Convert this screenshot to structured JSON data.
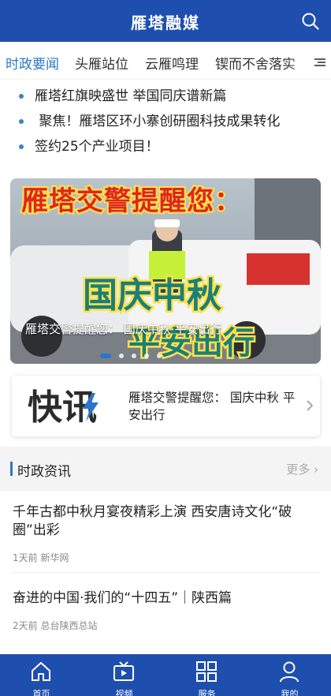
{
  "header": {
    "title": "雁塔融媒",
    "search_icon": "search-icon"
  },
  "tabs": [
    {
      "label": "时政要闻",
      "active": true
    },
    {
      "label": "头雁站位",
      "active": false
    },
    {
      "label": "云雁鸣理",
      "active": false
    },
    {
      "label": "锲而不舍落实",
      "active": false
    }
  ],
  "bullets": [
    {
      "text": "雁塔红旗映盛世  举国同庆谱新篇"
    },
    {
      "text": "  聚焦！雁塔区环小寨创研圈科技成果转化"
    },
    {
      "text": "签约25个产业项目！"
    }
  ],
  "banner": {
    "image_line1": "雁塔交警提醒您：",
    "image_line2": "国庆中秋",
    "image_line3": "平安出行",
    "caption": "雁塔交警提醒您：  国庆中秋  平安出行",
    "dot_count": 5,
    "active_dot": 0
  },
  "flash": {
    "logo_text": "快讯",
    "text": "雁塔交警提醒您：  国庆中秋  平安出行"
  },
  "section": {
    "title": "时政资讯",
    "more": "更多"
  },
  "news": [
    {
      "title": "千年古都中秋月宴夜精彩上演  西安唐诗文化“破圈”出彩",
      "time": "1天前",
      "source": "新华网"
    },
    {
      "title": "奋进的中国·我们的“十四五”｜陕西篇",
      "time": "2天前",
      "source": "总台陕西总站"
    }
  ],
  "bottom_nav": [
    {
      "label": "首页",
      "icon": "home-icon"
    },
    {
      "label": "视频",
      "icon": "tv-icon"
    },
    {
      "label": "服务",
      "icon": "grid-icon"
    },
    {
      "label": "我的",
      "icon": "user-icon"
    }
  ],
  "colors": {
    "brand_blue": "#1f4fae",
    "accent_blue": "#2a77c9",
    "banner_yellow": "#ffd23a",
    "banner_teal": "#1a7f79"
  }
}
